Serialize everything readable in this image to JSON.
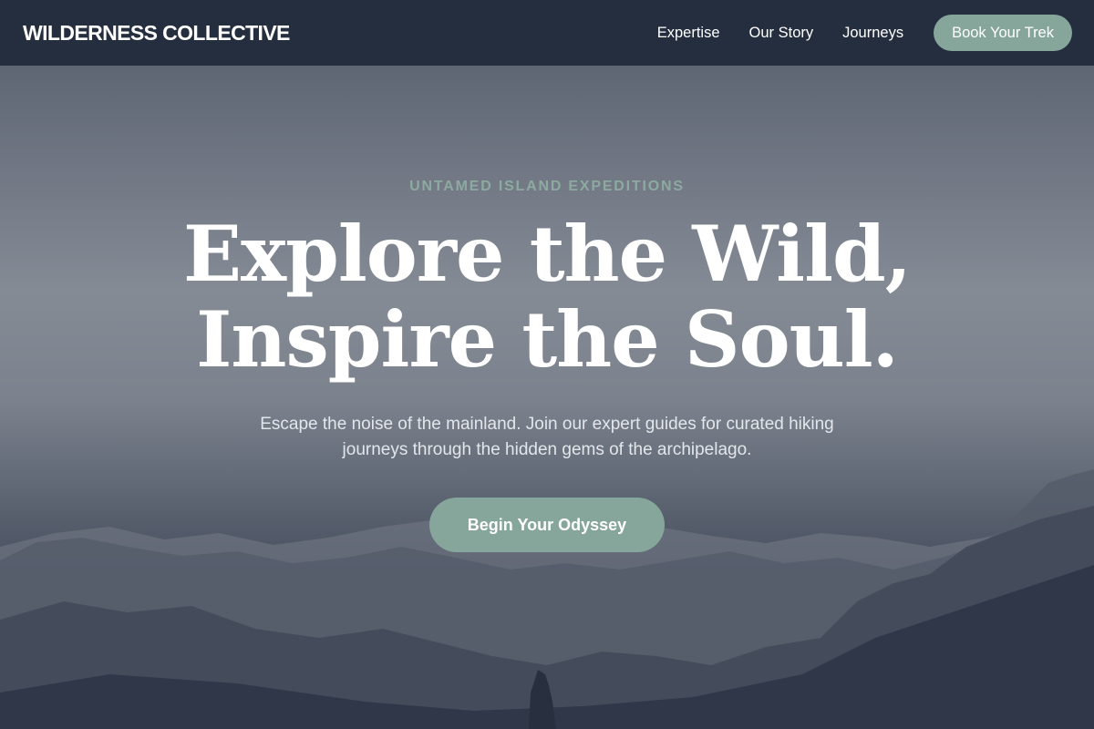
{
  "nav": {
    "brand": "WILDERNESS COLLECTIVE",
    "links": [
      "Expertise",
      "Our Story",
      "Journeys"
    ],
    "cta_label": "Book Your Trek"
  },
  "hero": {
    "eyebrow": "UNTAMED ISLAND EXPEDITIONS",
    "headline_line1": "Explore the Wild,",
    "headline_line2": "Inspire the Soul.",
    "subtext": "Escape the noise of the mainland. Join our expert guides for curated hiking journeys through the hidden gems of the archipelago.",
    "cta_label": "Begin Your Odyssey",
    "background_image": "misty-mountain-range"
  },
  "colors": {
    "nav_background": "#252e3e",
    "accent": "#86a59b",
    "eyebrow": "#8daaa0",
    "text_light": "#ffffff"
  }
}
